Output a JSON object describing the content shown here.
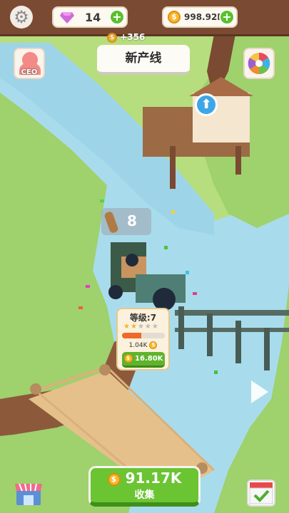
{
  "top_bar": {
    "gems": "14",
    "coins": "998.92M"
  },
  "floating_income": "+356",
  "new_line_button": "新产线",
  "ceo_button": "CEO",
  "wood_counter": "8",
  "upgrade_panel": {
    "level_label": "等级:7",
    "stars_filled": 2,
    "stars_total": 5,
    "progress": 0.45,
    "upgrade_cost": "1.04K",
    "button_value": "16.80K"
  },
  "collect": {
    "amount": "91.17K",
    "label": "收集"
  },
  "colors": {
    "top_bar": "#7a4a32",
    "grass": "#9fd16c",
    "river": "#a8dcec",
    "button_green": "#6bc432",
    "coin": "#f6b929"
  }
}
